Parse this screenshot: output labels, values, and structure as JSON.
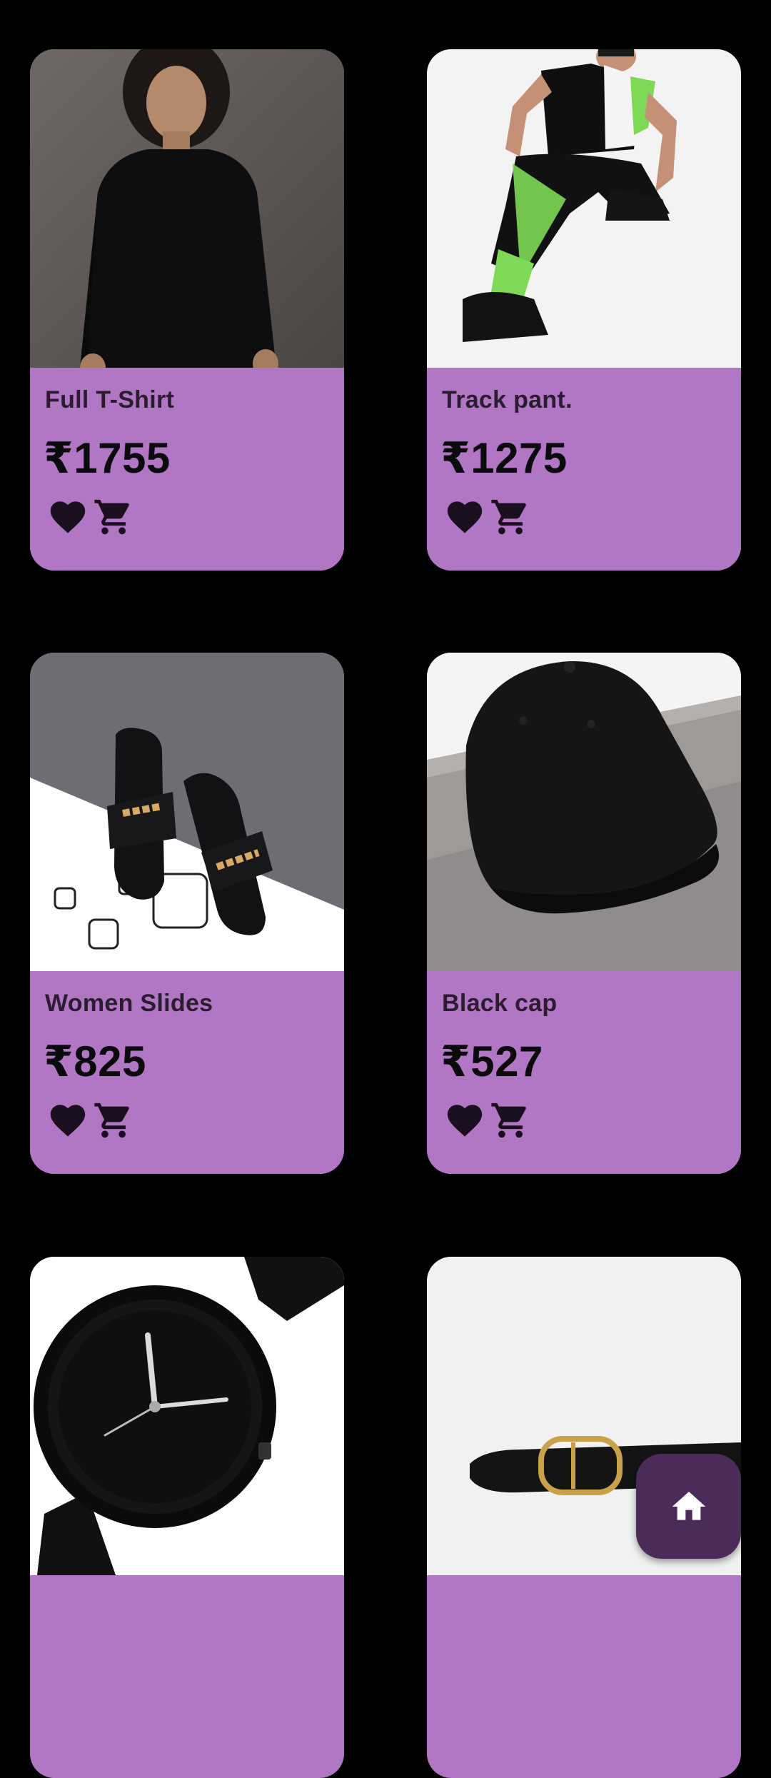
{
  "products": [
    {
      "name": "Full T-Shirt",
      "price": "₹1755",
      "image": "black-long-sleeve-tshirt-photo"
    },
    {
      "name": "Track pant.",
      "price": "₹1275",
      "image": "track-pant-model-photo"
    },
    {
      "name": "Women Slides",
      "price": "₹825",
      "image": "black-slides-photo"
    },
    {
      "name": "Black cap",
      "price": "₹527",
      "image": "black-cap-photo"
    },
    {
      "name": "",
      "price": "",
      "image": "black-watch-photo"
    },
    {
      "name": "",
      "price": "",
      "image": "black-belt-photo"
    }
  ],
  "icons": {
    "favorite": "heart-icon",
    "cart": "cart-icon",
    "home": "home-icon"
  },
  "colors": {
    "background": "#000000",
    "card": "#b177c4",
    "fab": "#4b2b5a",
    "icon": "#1a0f1f"
  }
}
